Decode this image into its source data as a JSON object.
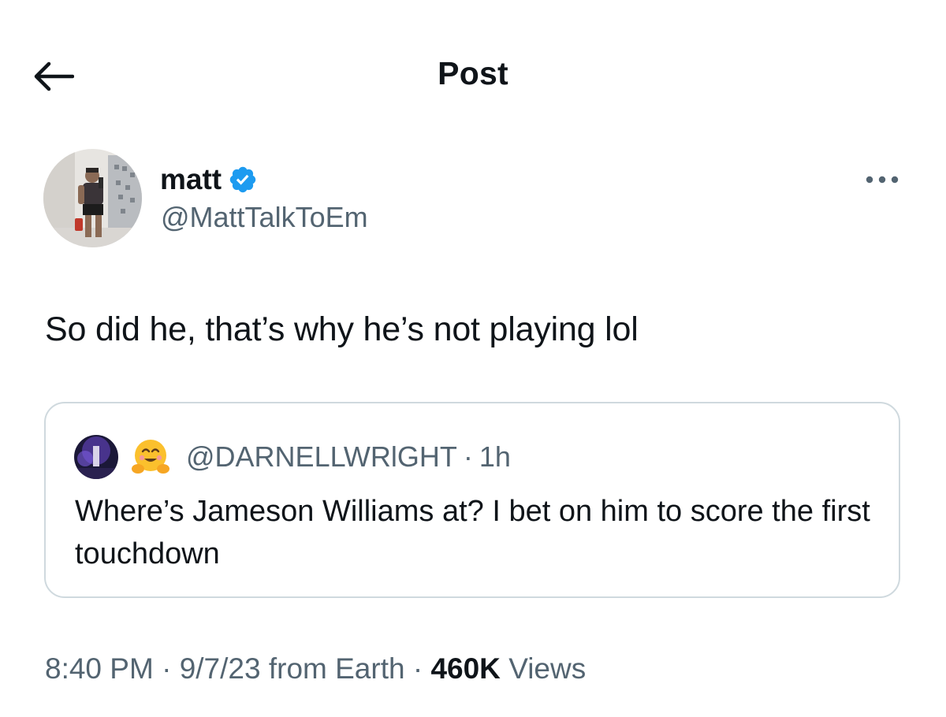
{
  "header": {
    "title": "Post",
    "back_icon": "arrow-left-icon"
  },
  "post": {
    "author": {
      "name": "matt",
      "handle": "@MattTalkToEm",
      "verified": true,
      "verified_color": "#1d9bf0"
    },
    "text": "So did he, that’s why he’s not playing lol",
    "quoted": {
      "emoji": "hugging-face-emoji",
      "handle": "@DARNELLWRlGHT",
      "separator": "·",
      "time": "1h",
      "text": "Where’s Jameson Williams at? I bet on him to score the first touchdown"
    },
    "meta": {
      "time": "8:40 PM",
      "date": "9/7/23",
      "source": "from Earth",
      "separator": "·",
      "views_count": "460K",
      "views_label": "Views"
    }
  },
  "colors": {
    "text_primary": "#0f1419",
    "text_secondary": "#536471",
    "border": "#cfd9de",
    "accent": "#1d9bf0"
  }
}
